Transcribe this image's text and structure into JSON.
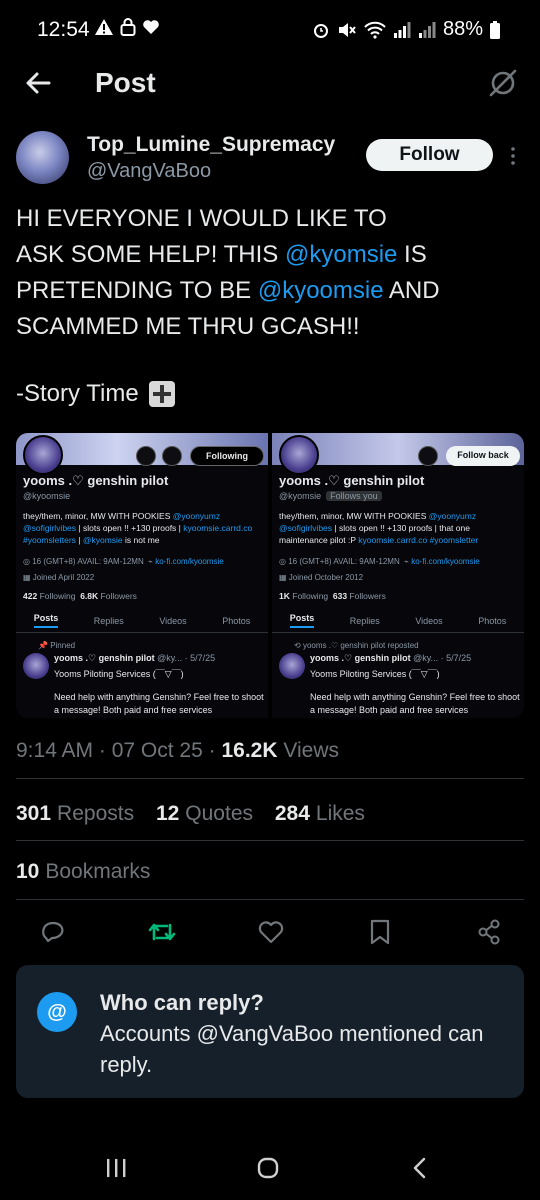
{
  "status_bar": {
    "time": "12:54",
    "battery": "88%"
  },
  "header": {
    "title": "Post"
  },
  "author": {
    "display_name": "Top_Lumine_Supremacy",
    "handle": "@VangVaBoo",
    "follow_label": "Follow"
  },
  "tweet": {
    "line1": "HI EVERYONE I WOULD LIKE TO",
    "line2": "ASK SOME HELP! THIS",
    "mention1": "@kyomsie",
    "line2b": " IS",
    "line3a": "PRETENDING TO BE ",
    "mention2": "@kyoomsie",
    "line3b": " AND",
    "line4": "SCAMMED ME THRU GCASH!!",
    "story": "-Story Time"
  },
  "media": {
    "left": {
      "following_label": "Following",
      "name": "yooms .♡ genshin pilot",
      "handle": "@kyoomsie",
      "bio_1": "they/them, minor, MW WITH POOKIES ",
      "bio_link1": "@yoonyumz",
      "bio_link2": "@sofigirlvibes",
      "bio_2": " | slots open !! +130 proofs |",
      "bio_link3": "kyoomsie.carrd.co",
      "bio_link4": "#yoomsletters",
      "bio_3": " | ",
      "bio_link5": "@kyomsie",
      "bio_4": " is not me",
      "meta": "16 (GMT+8) AVAIL: 9AM-12MN",
      "meta_link": "ko-fi.com/kyoomsie",
      "joined": "Joined April 2022",
      "following_count": "422",
      "following_word": "Following",
      "followers_count": "6.8K",
      "followers_word": "Followers",
      "tabs": [
        "Posts",
        "Replies",
        "Videos",
        "Photos"
      ],
      "pinned": "Pinned",
      "post_name": "yooms .♡ genshin pilot",
      "post_handle": "@ky...",
      "post_date": "5/7/25",
      "post_sub": "Yooms Piloting Services (￣▽￣)",
      "post_text": "Need help with anything Genshin? Feel free to shoot a message! Both paid and free services"
    },
    "right": {
      "follow_back_label": "Follow back",
      "name": "yooms .♡ genshin pilot",
      "handle": "@kyomsie",
      "follows_you": "Follows you",
      "bio_1": "they/them, minor, MW WITH POOKIES ",
      "bio_link1": "@yoonyumz",
      "bio_link2": "@sofigirlvibes",
      "bio_2": " | slots open !! +130 proofs | that one maintenance pilot :P ",
      "bio_link3": "kyoomsie.carrd.co",
      "bio_link4": "#yoomsletter",
      "meta": "16 (GMT+8) AVAIL: 9AM-12MN",
      "meta_link": "ko-fi.com/kyoomsie",
      "joined": "Joined October 2012",
      "following_count": "1K",
      "following_word": "Following",
      "followers_count": "633",
      "followers_word": "Followers",
      "tabs": [
        "Posts",
        "Replies",
        "Videos",
        "Photos"
      ],
      "reposted": "yooms .♡ genshin pilot reposted",
      "post_name": "yooms .♡ genshin pilot",
      "post_handle": "@ky...",
      "post_date": "5/7/25",
      "post_sub": "Yooms Piloting Services (￣▽￣)",
      "post_text": "Need help with anything Genshin? Feel free to shoot a message! Both paid and free services"
    }
  },
  "meta": {
    "time": "9:14 AM",
    "sep": " · ",
    "date": "07 Oct 25",
    "views_count": "16.2K",
    "views_label": " Views"
  },
  "stats": {
    "reposts_count": "301",
    "reposts_label": "Reposts",
    "quotes_count": "12",
    "quotes_label": "Quotes",
    "likes_count": "284",
    "likes_label": "Likes",
    "bookmarks_count": "10",
    "bookmarks_label": "Bookmarks"
  },
  "reply_restriction": {
    "icon": "@",
    "title": "Who can reply?",
    "description": "Accounts @VangVaBoo mentioned can reply."
  },
  "colors": {
    "accent": "#1d9bf0",
    "repost_active": "#00ba7c",
    "background": "#000000"
  },
  "icons": [
    "back-arrow-icon",
    "grok-icon",
    "more-vertical-icon",
    "reply-icon",
    "repost-icon",
    "like-icon",
    "bookmark-icon",
    "share-icon",
    "at-icon"
  ]
}
